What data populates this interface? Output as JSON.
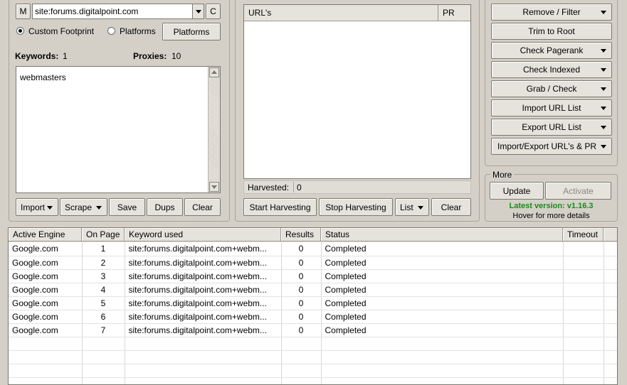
{
  "footprint": {
    "m_label": "M",
    "query_value": "site:forums.digitalpoint.com",
    "c_label": "C",
    "custom_label": "Custom Footprint",
    "platforms_radio_label": "Platforms",
    "platforms_button_label": "Platforms"
  },
  "keywords": {
    "label": "Keywords:",
    "count": "1",
    "proxies_label": "Proxies:",
    "proxies_count": "10",
    "text": "webmasters"
  },
  "keyword_buttons": [
    "Import",
    "Scrape",
    "Save",
    "Dups",
    "Clear"
  ],
  "urls": {
    "col_url": "URL's",
    "col_pr": "PR",
    "harvested_label": "Harvested:",
    "harvested_value": "0"
  },
  "url_buttons": [
    "Start Harvesting",
    "Stop Harvesting",
    "List",
    "Clear"
  ],
  "actions": [
    "Remove / Filter",
    "Trim to Root",
    "Check Pagerank",
    "Check Indexed",
    "Grab / Check",
    "Import URL List",
    "Export URL List",
    "Import/Export URL's & PR"
  ],
  "more": {
    "title": "More",
    "update_label": "Update",
    "activate_label": "Activate",
    "version_text": "Latest version: v1.16.3",
    "hover_text": "Hover for more details",
    "version_color": "#1a8a1a"
  },
  "engines_table": {
    "headers": [
      "Active Engine",
      "On Page",
      "Keyword used",
      "Results",
      "Status",
      "Timeout"
    ],
    "rows": [
      [
        "Google.com",
        "1",
        "site:forums.digitalpoint.com+webm...",
        "0",
        "Completed",
        ""
      ],
      [
        "Google.com",
        "2",
        "site:forums.digitalpoint.com+webm...",
        "0",
        "Completed",
        ""
      ],
      [
        "Google.com",
        "3",
        "site:forums.digitalpoint.com+webm...",
        "0",
        "Completed",
        ""
      ],
      [
        "Google.com",
        "4",
        "site:forums.digitalpoint.com+webm...",
        "0",
        "Completed",
        ""
      ],
      [
        "Google.com",
        "5",
        "site:forums.digitalpoint.com+webm...",
        "0",
        "Completed",
        ""
      ],
      [
        "Google.com",
        "6",
        "site:forums.digitalpoint.com+webm...",
        "0",
        "Completed",
        ""
      ],
      [
        "Google.com",
        "7",
        "site:forums.digitalpoint.com+webm...",
        "0",
        "Completed",
        ""
      ]
    ]
  }
}
